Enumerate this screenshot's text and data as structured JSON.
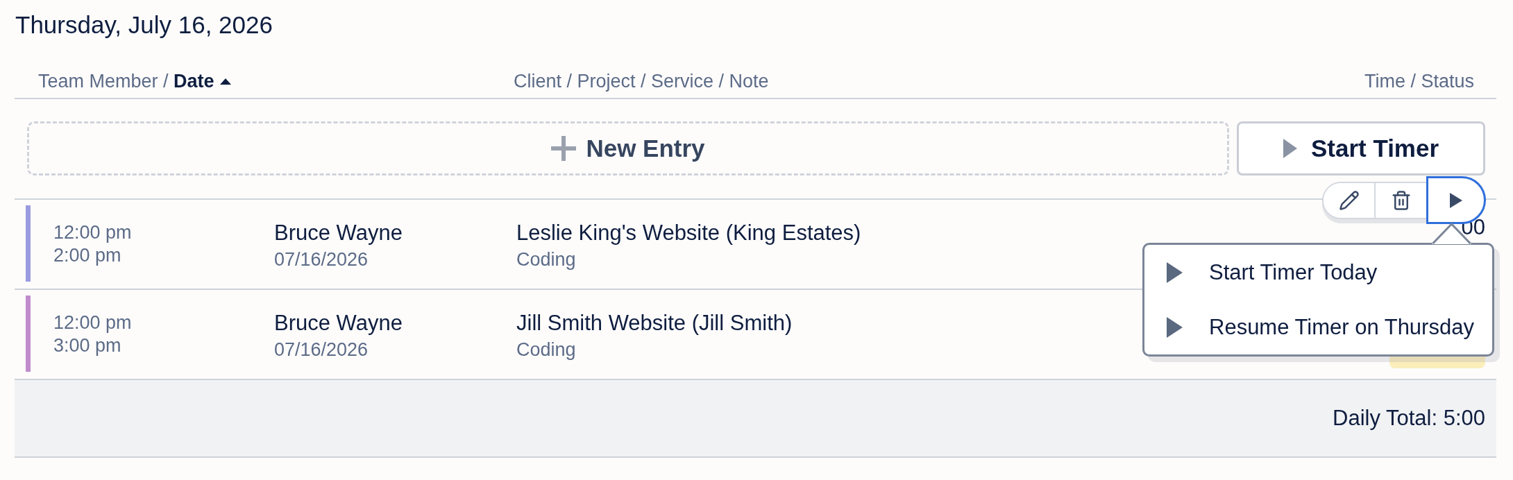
{
  "date_heading": "Thursday, July 16, 2026",
  "columns": [
    {
      "label": "Team Member / **Date**",
      "sorted": true,
      "ascending": true
    },
    {
      "label": "Client / Project / Service / Note",
      "sorted": false
    },
    {
      "label": "Time / Status",
      "sorted": false
    }
  ],
  "new_entry_button": {
    "label": "New Entry"
  },
  "start_timer_button": {
    "label": "Start Timer"
  },
  "entries": [
    {
      "color": "#9b9be0",
      "start": "12:00 pm",
      "end": "2:00 pm",
      "member": "Bruce Wayne",
      "date": "07/16/2026",
      "project": "Leslie King's Website (King Estates)",
      "service": "Coding",
      "time": "00"
    },
    {
      "color": "#c08ccc",
      "start": "12:00 pm",
      "end": "3:00 pm",
      "member": "Bruce Wayne",
      "date": "07/16/2026",
      "project": "Jill Smith Website (Jill Smith)",
      "service": "Coding",
      "badge": true
    }
  ],
  "row_actions": [
    {
      "kind": "edit",
      "focused": false
    },
    {
      "kind": "delete",
      "focused": false
    },
    {
      "kind": "play",
      "focused": true
    }
  ],
  "timer_menu": {
    "items": [
      {
        "label": "Start Timer Today"
      },
      {
        "label": "Resume Timer on Thursday"
      }
    ]
  },
  "daily_total": "Daily Total: 5:00"
}
